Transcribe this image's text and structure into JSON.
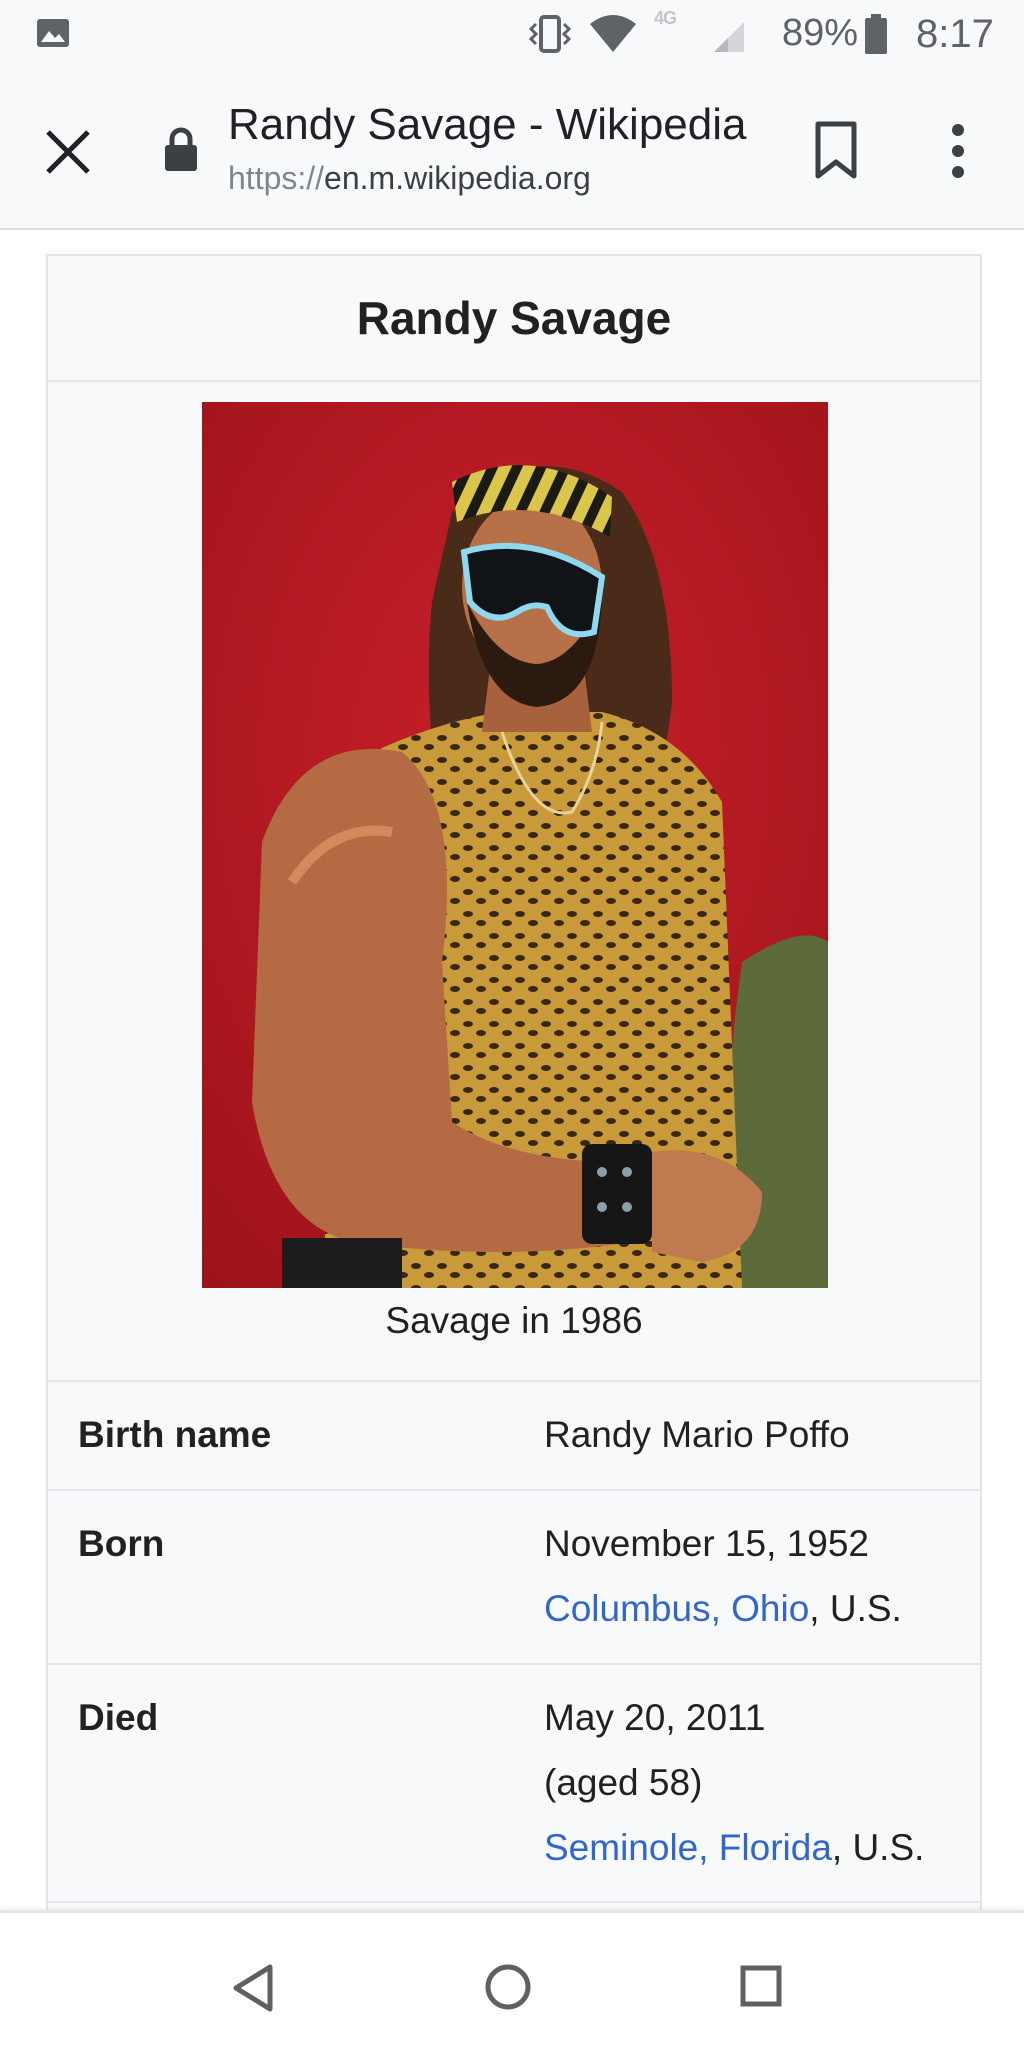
{
  "status_bar": {
    "network": "4G",
    "battery": "89%",
    "time": "8:17",
    "icons": [
      "gallery-icon",
      "vibrate-icon",
      "wifi-icon",
      "signal-icon",
      "battery-icon"
    ]
  },
  "toolbar": {
    "page_title": "Randy Savage - Wikipedia",
    "url_scheme": "https://",
    "url_host": "en.m.wikipedia.org",
    "icons": [
      "close-icon",
      "lock-icon",
      "bookmark-icon",
      "more-vert-icon"
    ]
  },
  "infobox": {
    "title": "Randy Savage",
    "caption": "Savage in 1986",
    "rows": {
      "birth_name": {
        "label": "Birth name",
        "value": "Randy Mario Poffo"
      },
      "born": {
        "label": "Born",
        "date": "November 15, 1952",
        "place_link": "Columbus, Ohio",
        "place_suffix": ", U.S."
      },
      "died": {
        "label": "Died",
        "date": "May 20, 2011",
        "age": "(aged 58)",
        "place_link": "Seminole, Florida",
        "place_suffix": ", U.S."
      }
    }
  },
  "nav_bar": {
    "icons": [
      "back-icon",
      "home-icon",
      "recents-icon"
    ]
  },
  "colors": {
    "link": "#3366cc",
    "infobox_bg": "#f8f9fa",
    "toolbar_bg": "#f8f9fa",
    "photo_background": "#b6161f"
  }
}
